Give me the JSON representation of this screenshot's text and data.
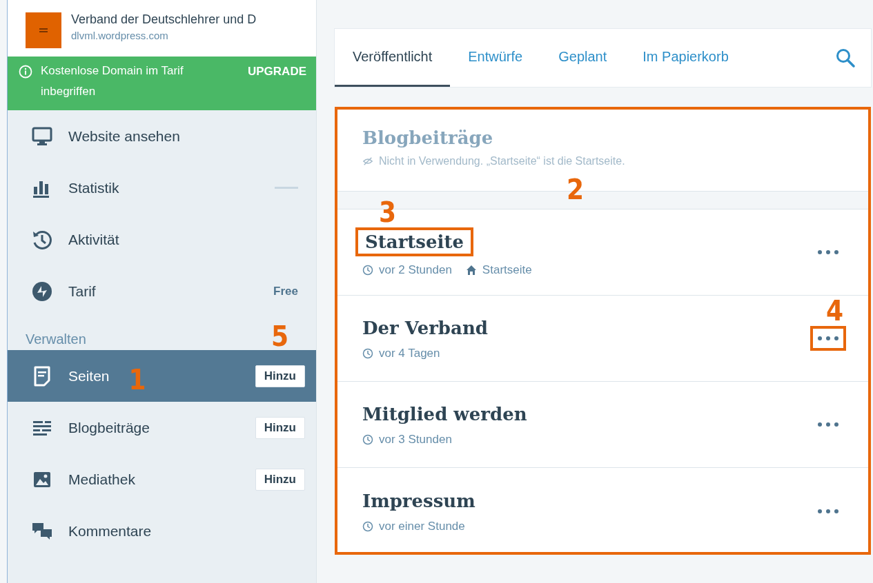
{
  "site": {
    "name": "Verband der Deutschlehrer und D",
    "url": "dlvml.wordpress.com"
  },
  "notice": {
    "text": "Kostenlose Domain im Tarif inbegriffen",
    "action": "UPGRADE"
  },
  "sidebar": {
    "items": [
      {
        "label": "Website ansehen",
        "selected": false
      },
      {
        "label": "Statistik",
        "selected": false,
        "sparkline": true
      },
      {
        "label": "Aktivität",
        "selected": false
      },
      {
        "label": "Tarif",
        "selected": false,
        "badge": "Free"
      }
    ],
    "section": {
      "title": "Verwalten",
      "marker": "5"
    },
    "manage_items": [
      {
        "label": "Seiten",
        "selected": true,
        "add_button": "Hinzu",
        "marker": "1"
      },
      {
        "label": "Blogbeiträge",
        "selected": false,
        "add_button": "Hinzu"
      },
      {
        "label": "Mediathek",
        "selected": false,
        "add_button": "Hinzu"
      },
      {
        "label": "Kommentare",
        "selected": false
      }
    ]
  },
  "tabs": [
    {
      "label": "Veröffentlicht",
      "selected": true
    },
    {
      "label": "Entwürfe",
      "selected": false
    },
    {
      "label": "Geplant",
      "selected": false
    },
    {
      "label": "Im Papierkorb",
      "selected": false
    }
  ],
  "card": {
    "marker": "2",
    "blog_posts": {
      "title": "Blogbeiträge",
      "note": "Nicht in Verwendung. „Startseite“ ist die Startseite."
    },
    "pages": [
      {
        "title": "Startseite",
        "time": "vor 2 Stunden",
        "front_page": "Startseite",
        "title_marker": "3"
      },
      {
        "title": "Der Verband",
        "time": "vor 4 Tagen",
        "menu_marker": "4"
      },
      {
        "title": "Mitglied werden",
        "time": "vor 3 Stunden"
      },
      {
        "title": "Impressum",
        "time": "vor einer Stunde"
      }
    ]
  }
}
